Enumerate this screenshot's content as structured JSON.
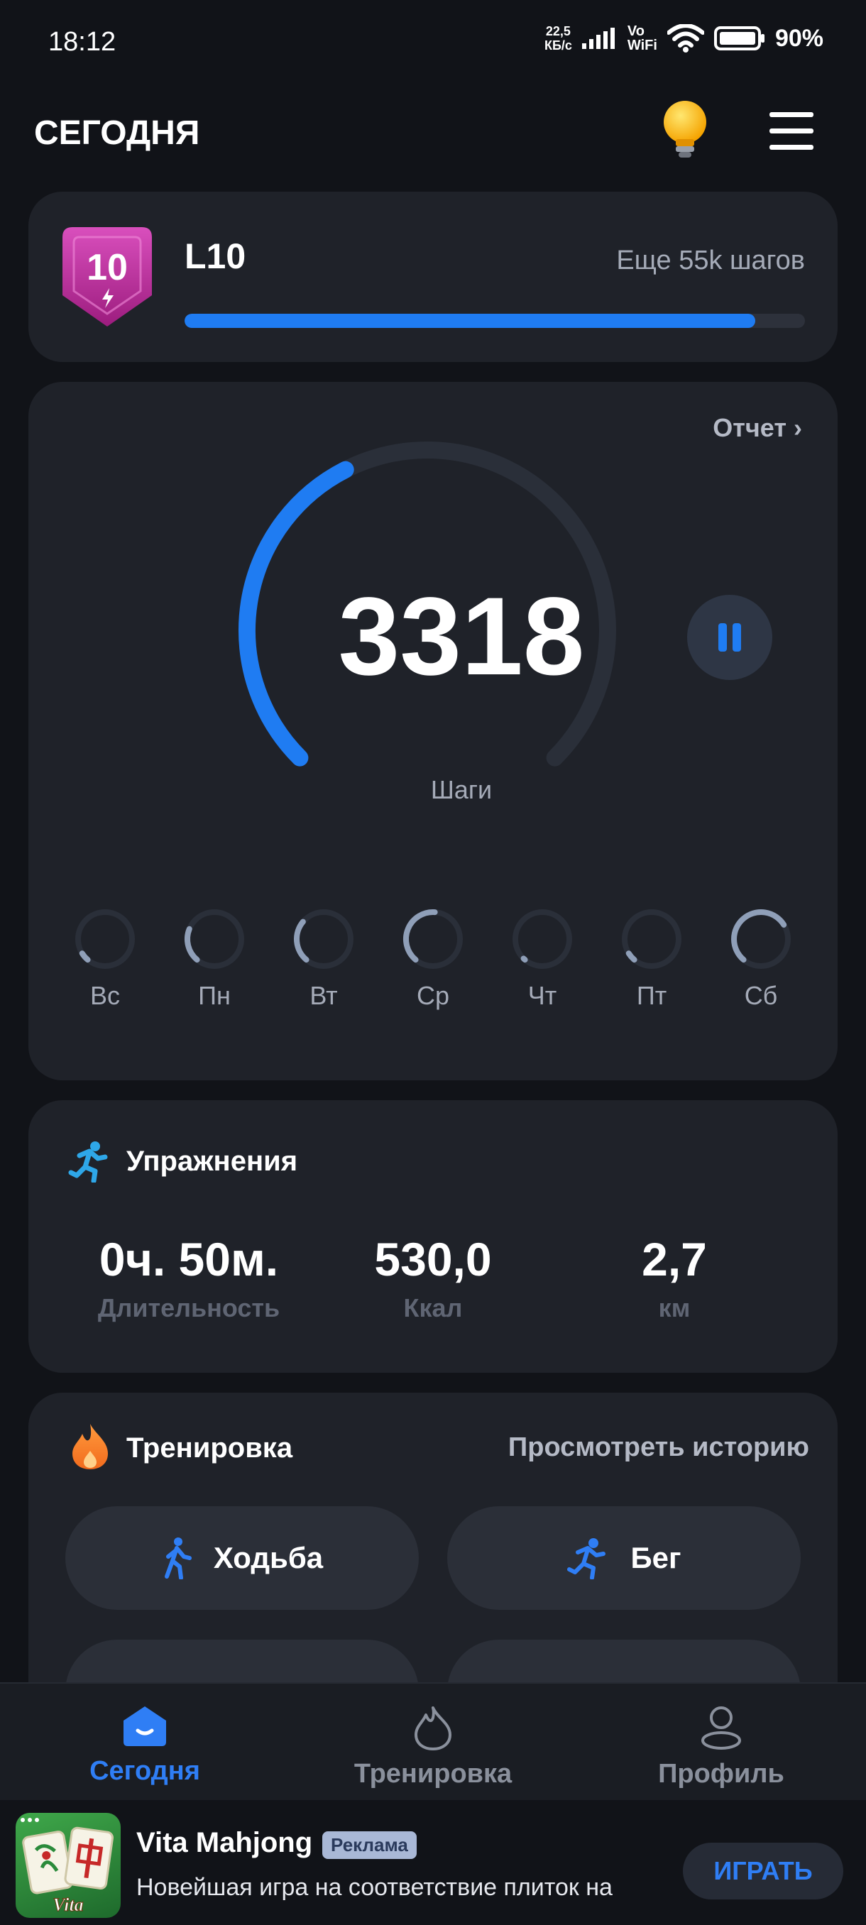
{
  "status_bar": {
    "time": "18:12",
    "net_speed_value": "22,5",
    "net_speed_unit": "КБ/с",
    "vo_label": "Vo",
    "wifi_label": "WiFi",
    "battery_percent": "90%"
  },
  "header": {
    "title": "СЕГОДНЯ"
  },
  "level": {
    "badge_number": "10",
    "name": "L10",
    "remaining": "Еще 55k шагов",
    "progress": 0.92
  },
  "steps": {
    "report_label": "Отчет",
    "value": "3318",
    "label": "Шаги",
    "gauge_progress": 0.4,
    "days": [
      {
        "label": "Вс",
        "progress": 0.05
      },
      {
        "label": "Пн",
        "progress": 0.2
      },
      {
        "label": "Вт",
        "progress": 0.25
      },
      {
        "label": "Ср",
        "progress": 0.4
      },
      {
        "label": "Чт",
        "progress": 0.0
      },
      {
        "label": "Пт",
        "progress": 0.05
      },
      {
        "label": "Сб",
        "progress": 0.55
      }
    ]
  },
  "exercises": {
    "title": "Упражнения",
    "duration_value": "0ч. 50м.",
    "duration_label": "Длительность",
    "kcal_value": "530,0",
    "kcal_label": "Ккал",
    "distance_value": "2,7",
    "distance_label": "км"
  },
  "training": {
    "title": "Тренировка",
    "history_link": "Просмотреть историю",
    "buttons": [
      {
        "label": "Ходьба",
        "icon": "walking-icon"
      },
      {
        "label": "Бег",
        "icon": "running-icon"
      }
    ]
  },
  "bottom_nav": {
    "items": [
      {
        "label": "Сегодня",
        "icon": "home-icon",
        "active": true
      },
      {
        "label": "Тренировка",
        "icon": "flame-outline-icon",
        "active": false
      },
      {
        "label": "Профиль",
        "icon": "person-icon",
        "active": false
      }
    ]
  },
  "ad": {
    "title": "Vita Mahjong",
    "badge": "Реклама",
    "subtitle": "Новейшая игра на соответствие плиток на",
    "button_label": "ИГРАТЬ",
    "icon_text": "Vita"
  },
  "colors": {
    "accent": "#1f7cf2",
    "card": "#1f2229",
    "background": "#111318",
    "muted_text": "#a5abb8"
  }
}
